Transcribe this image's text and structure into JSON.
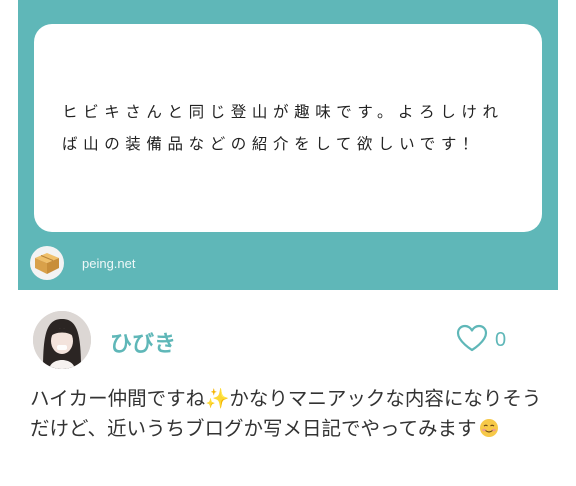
{
  "question": {
    "text": "ヒビキさんと同じ登山が趣味です。よろしければ山の装備品などの紹介をして欲しいです！"
  },
  "site": {
    "name": "peing.net"
  },
  "user": {
    "name": "ひびき"
  },
  "like": {
    "count": "0"
  },
  "answer": {
    "part1": "ハイカー仲間ですね",
    "sparkle": "✨",
    "part2": "かなりマニアックな内容になりそうだけど、近いうちブログか写メ日記でやってみます",
    "smile": "☺"
  },
  "colors": {
    "accent": "#5fb7b8",
    "card_bg": "#5fb7b8",
    "text": "#333333"
  }
}
